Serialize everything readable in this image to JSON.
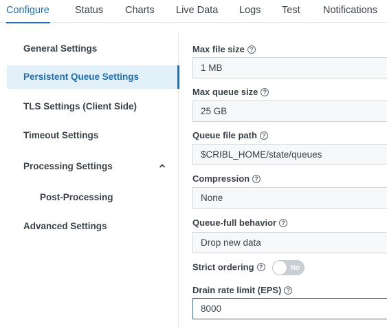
{
  "tabs": [
    {
      "label": "Configure"
    },
    {
      "label": "Status"
    },
    {
      "label": "Charts"
    },
    {
      "label": "Live Data"
    },
    {
      "label": "Logs"
    },
    {
      "label": "Test"
    },
    {
      "label": "Notifications"
    }
  ],
  "sidebar": {
    "items": [
      {
        "label": "General Settings"
      },
      {
        "label": "Persistent Queue Settings"
      },
      {
        "label": "TLS Settings (Client Side)"
      },
      {
        "label": "Timeout Settings"
      },
      {
        "label": "Processing Settings"
      },
      {
        "label": "Post-Processing"
      },
      {
        "label": "Advanced Settings"
      }
    ]
  },
  "form": {
    "max_file_size": {
      "label": "Max file size",
      "value": "1 MB"
    },
    "max_queue_size": {
      "label": "Max queue size",
      "value": "25 GB"
    },
    "queue_file_path": {
      "label": "Queue file path",
      "value": "$CRIBL_HOME/state/queues"
    },
    "compression": {
      "label": "Compression",
      "value": "None"
    },
    "queue_full_behavior": {
      "label": "Queue-full behavior",
      "value": "Drop new data"
    },
    "strict_ordering": {
      "label": "Strict ordering",
      "toggle_text": "No"
    },
    "drain_rate_limit": {
      "label": "Drain rate limit (EPS)",
      "value": "8000"
    }
  },
  "help_glyph": "?",
  "colors": {
    "accent": "#1e6fb6",
    "active_bg": "#e2f0fa",
    "toggle_off": "#c9ced3"
  }
}
